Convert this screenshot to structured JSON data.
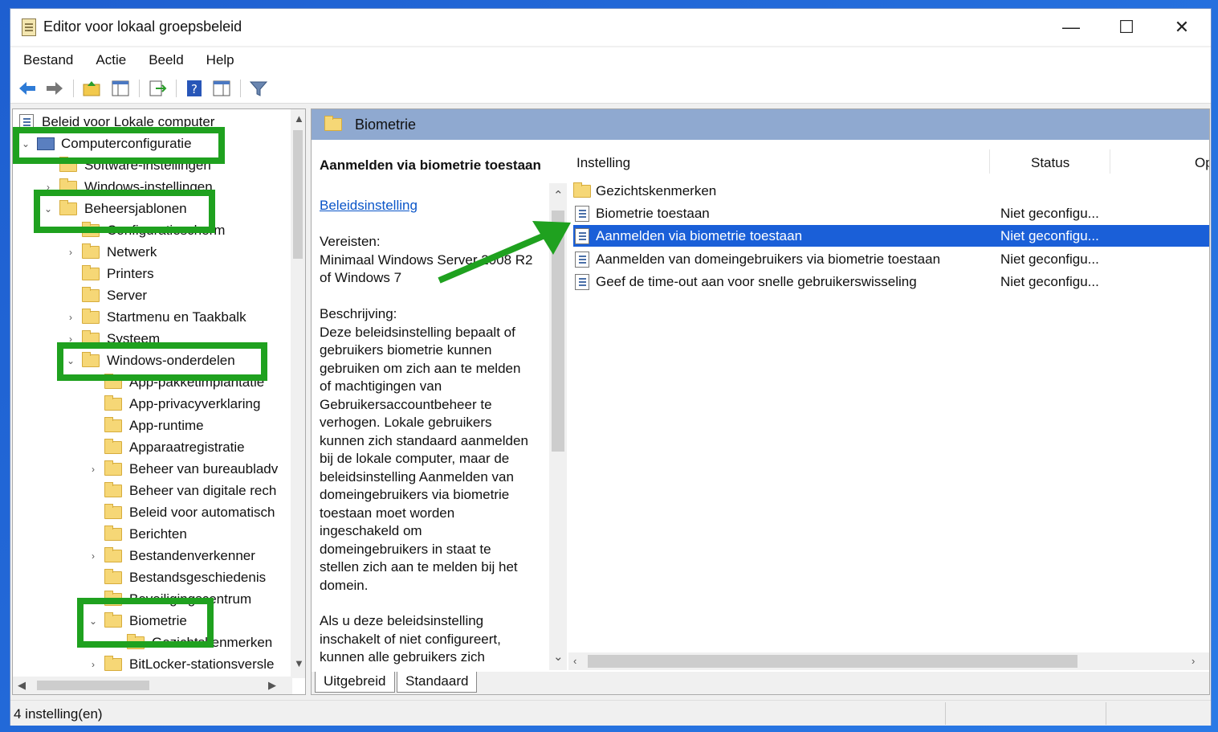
{
  "window": {
    "title": "Editor voor lokaal groepsbeleid",
    "minimize": "—",
    "maximize": "☐",
    "close": "✕"
  },
  "menu": [
    "Bestand",
    "Actie",
    "Beeld",
    "Help"
  ],
  "tree": {
    "items": [
      {
        "label": "Beleid voor Lokale computer",
        "chevron": ""
      },
      {
        "label": "Computerconfiguratie",
        "chevron": "⌄"
      },
      {
        "label": "Software-instellingen",
        "chevron": ""
      },
      {
        "label": "Windows-instellingen",
        "chevron": "›"
      },
      {
        "label": "Beheersjablonen",
        "chevron": "⌄"
      },
      {
        "label": "Configuratiescherm",
        "chevron": "›"
      },
      {
        "label": "Netwerk",
        "chevron": "›"
      },
      {
        "label": "Printers",
        "chevron": ""
      },
      {
        "label": "Server",
        "chevron": ""
      },
      {
        "label": "Startmenu en Taakbalk",
        "chevron": "›"
      },
      {
        "label": "Systeem",
        "chevron": "›"
      },
      {
        "label": "Windows-onderdelen",
        "chevron": "⌄"
      },
      {
        "label": "App-pakketimplantatie",
        "chevron": ""
      },
      {
        "label": "App-privacyverklaring",
        "chevron": ""
      },
      {
        "label": "App-runtime",
        "chevron": ""
      },
      {
        "label": "Apparaatregistratie",
        "chevron": ""
      },
      {
        "label": "Beheer van bureaubladv",
        "chevron": "›"
      },
      {
        "label": "Beheer van digitale rech",
        "chevron": ""
      },
      {
        "label": "Beleid voor automatisch",
        "chevron": ""
      },
      {
        "label": "Berichten",
        "chevron": ""
      },
      {
        "label": "Bestandenverkenner",
        "chevron": "›"
      },
      {
        "label": "Bestandsgeschiedenis",
        "chevron": ""
      },
      {
        "label": "Beveiligingscentrum",
        "chevron": ""
      },
      {
        "label": "Biometrie",
        "chevron": "⌄"
      },
      {
        "label": "Gezichtskenmerken",
        "chevron": ""
      },
      {
        "label": "BitLocker-stationsversle",
        "chevron": "›"
      }
    ]
  },
  "right": {
    "header": "Biometrie",
    "description": {
      "heading": "Aanmelden via biometrie toestaan",
      "link": "Beleidsinstelling",
      "requirements": "Vereisten:\nMinimaal Windows Server 2008 R2\nof Windows 7",
      "body": "Beschrijving:\nDeze beleidsinstelling bepaalt of\ngebruikers biometrie kunnen\ngebruiken om zich aan te melden\nof machtigingen van\nGebruikersaccountbeheer te\nverhogen.  Lokale gebruikers\nkunnen zich standaard aanmelden\nbij de lokale computer, maar de\nbeleidsinstelling Aanmelden van\ndomeingebruikers via biometrie\ntoestaan moet worden\ningeschakeld om\ndomeingebruikers in staat te\nstellen zich aan te melden bij het\ndomein.",
      "body2": "Als u deze beleidsinstelling\ninschakelt of niet configureert,\nkunnen alle gebruikers zich\naanmelden bij een lokale"
    },
    "columns": [
      "Instelling",
      "Status",
      "Opmerking"
    ],
    "rows": [
      {
        "name": "Gezichtskenmerken",
        "status": "",
        "type": "folder"
      },
      {
        "name": "Biometrie toestaan",
        "status": "Niet geconfigu...",
        "type": "policy"
      },
      {
        "name": "Aanmelden via biometrie toestaan",
        "status": "Niet geconfigu...",
        "type": "policy",
        "selected": true
      },
      {
        "name": "Aanmelden van domeingebruikers via biometrie toestaan",
        "status": "Niet geconfigu...",
        "type": "policy"
      },
      {
        "name": "Geef de time-out aan voor snelle gebruikerswisseling",
        "status": "Niet geconfigu...",
        "type": "policy"
      }
    ],
    "tabs": [
      "Uitgebreid",
      "Standaard"
    ]
  },
  "statusbar": "4 instelling(en)",
  "colors": {
    "highlight": "#1fa11f",
    "selection": "#1a5fd8",
    "header": "#8fa9d0"
  }
}
